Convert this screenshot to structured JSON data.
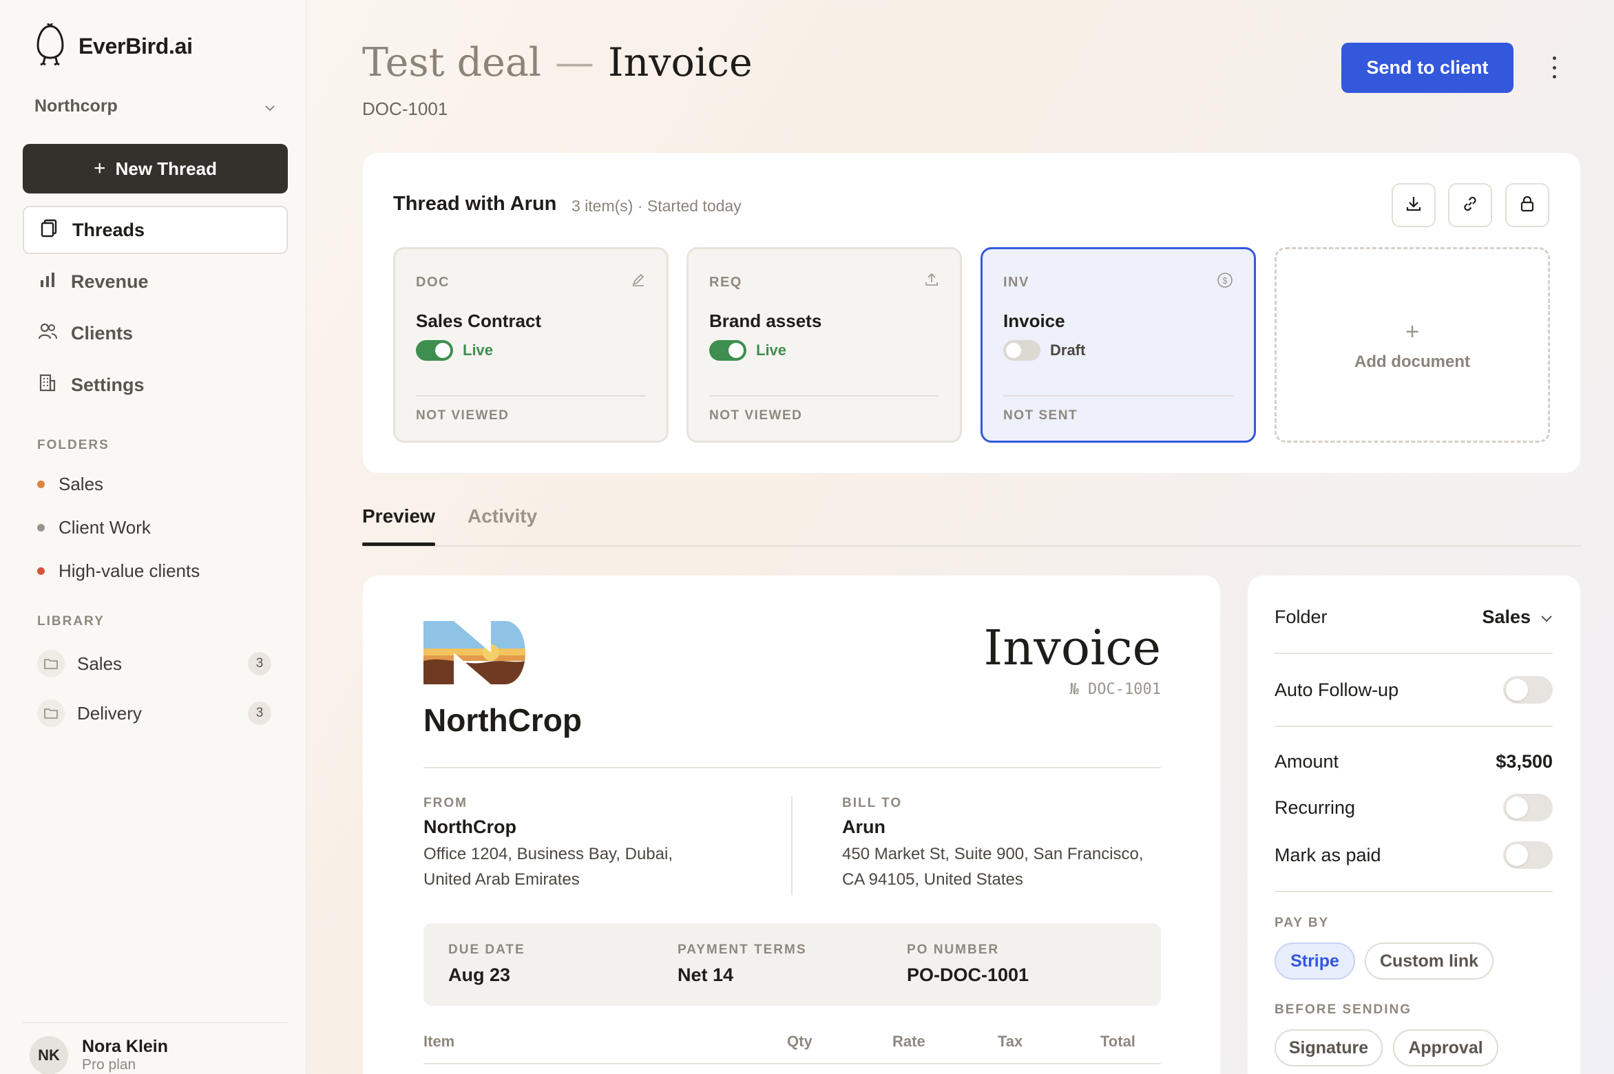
{
  "app": {
    "name": "EverBird.ai"
  },
  "org": {
    "name": "Northcorp"
  },
  "sidebar": {
    "new_thread": "New Thread",
    "nav": [
      {
        "label": "Threads",
        "icon": "copy-icon",
        "active": true
      },
      {
        "label": "Revenue",
        "icon": "bar-chart-icon",
        "active": false
      },
      {
        "label": "Clients",
        "icon": "users-icon",
        "active": false
      },
      {
        "label": "Settings",
        "icon": "building-icon",
        "active": false
      }
    ],
    "folders_title": "FOLDERS",
    "folders": [
      {
        "label": "Sales",
        "color": "#e0823a"
      },
      {
        "label": "Client Work",
        "color": "#9a948b"
      },
      {
        "label": "High-value clients",
        "color": "#d9533a"
      }
    ],
    "library_title": "LIBRARY",
    "library": [
      {
        "label": "Sales",
        "count": "3"
      },
      {
        "label": "Delivery",
        "count": "3"
      }
    ],
    "user": {
      "initials": "NK",
      "name": "Nora Klein",
      "plan": "Pro plan"
    }
  },
  "header": {
    "deal": "Test deal",
    "dash": "—",
    "doc": "Invoice",
    "doc_id": "DOC-1001",
    "send_button": "Send to client"
  },
  "thread": {
    "title": "Thread with Arun",
    "meta": "3 item(s) · Started today",
    "documents": [
      {
        "type": "DOC",
        "name": "Sales Contract",
        "status": "Live",
        "live": true,
        "view": "NOT VIEWED",
        "icon": "edit-icon"
      },
      {
        "type": "REQ",
        "name": "Brand assets",
        "status": "Live",
        "live": true,
        "view": "NOT VIEWED",
        "icon": "upload-icon"
      },
      {
        "type": "INV",
        "name": "Invoice",
        "status": "Draft",
        "live": false,
        "view": "NOT SENT",
        "icon": "dollar-circle-icon"
      }
    ],
    "add_document": "Add document",
    "add_plus": "+"
  },
  "tabs": [
    {
      "label": "Preview"
    },
    {
      "label": "Activity"
    }
  ],
  "invoice": {
    "company": "NorthCrop",
    "title": "Invoice",
    "number": "№ DOC-1001",
    "from_label": "FROM",
    "from_name": "NorthCrop",
    "from_addr1": "Office 1204, Business Bay, Dubai,",
    "from_addr2": "United Arab Emirates",
    "to_label": "BILL TO",
    "to_name": "Arun",
    "to_addr1": "450 Market St, Suite 900, San Francisco,",
    "to_addr2": "CA 94105, United States",
    "terms": [
      {
        "label": "DUE DATE",
        "value": "Aug 23"
      },
      {
        "label": "PAYMENT TERMS",
        "value": "Net 14"
      },
      {
        "label": "PO NUMBER",
        "value": "PO-DOC-1001"
      }
    ],
    "columns": [
      "Item",
      "Qty",
      "Rate",
      "Tax",
      "Total"
    ]
  },
  "settings": {
    "folder_label": "Folder",
    "folder_value": "Sales",
    "auto_followup": "Auto Follow-up",
    "amount_label": "Amount",
    "amount_value": "$3,500",
    "recurring": "Recurring",
    "mark_paid": "Mark as paid",
    "pay_by_label": "PAY BY",
    "pay_options": [
      "Stripe",
      "Custom link"
    ],
    "before_sending_label": "BEFORE SENDING",
    "before_options": [
      "Signature",
      "Approval"
    ]
  },
  "colors": {
    "accent": "#3358dc",
    "live": "#3e8f4f",
    "dark_button": "#34312c"
  }
}
